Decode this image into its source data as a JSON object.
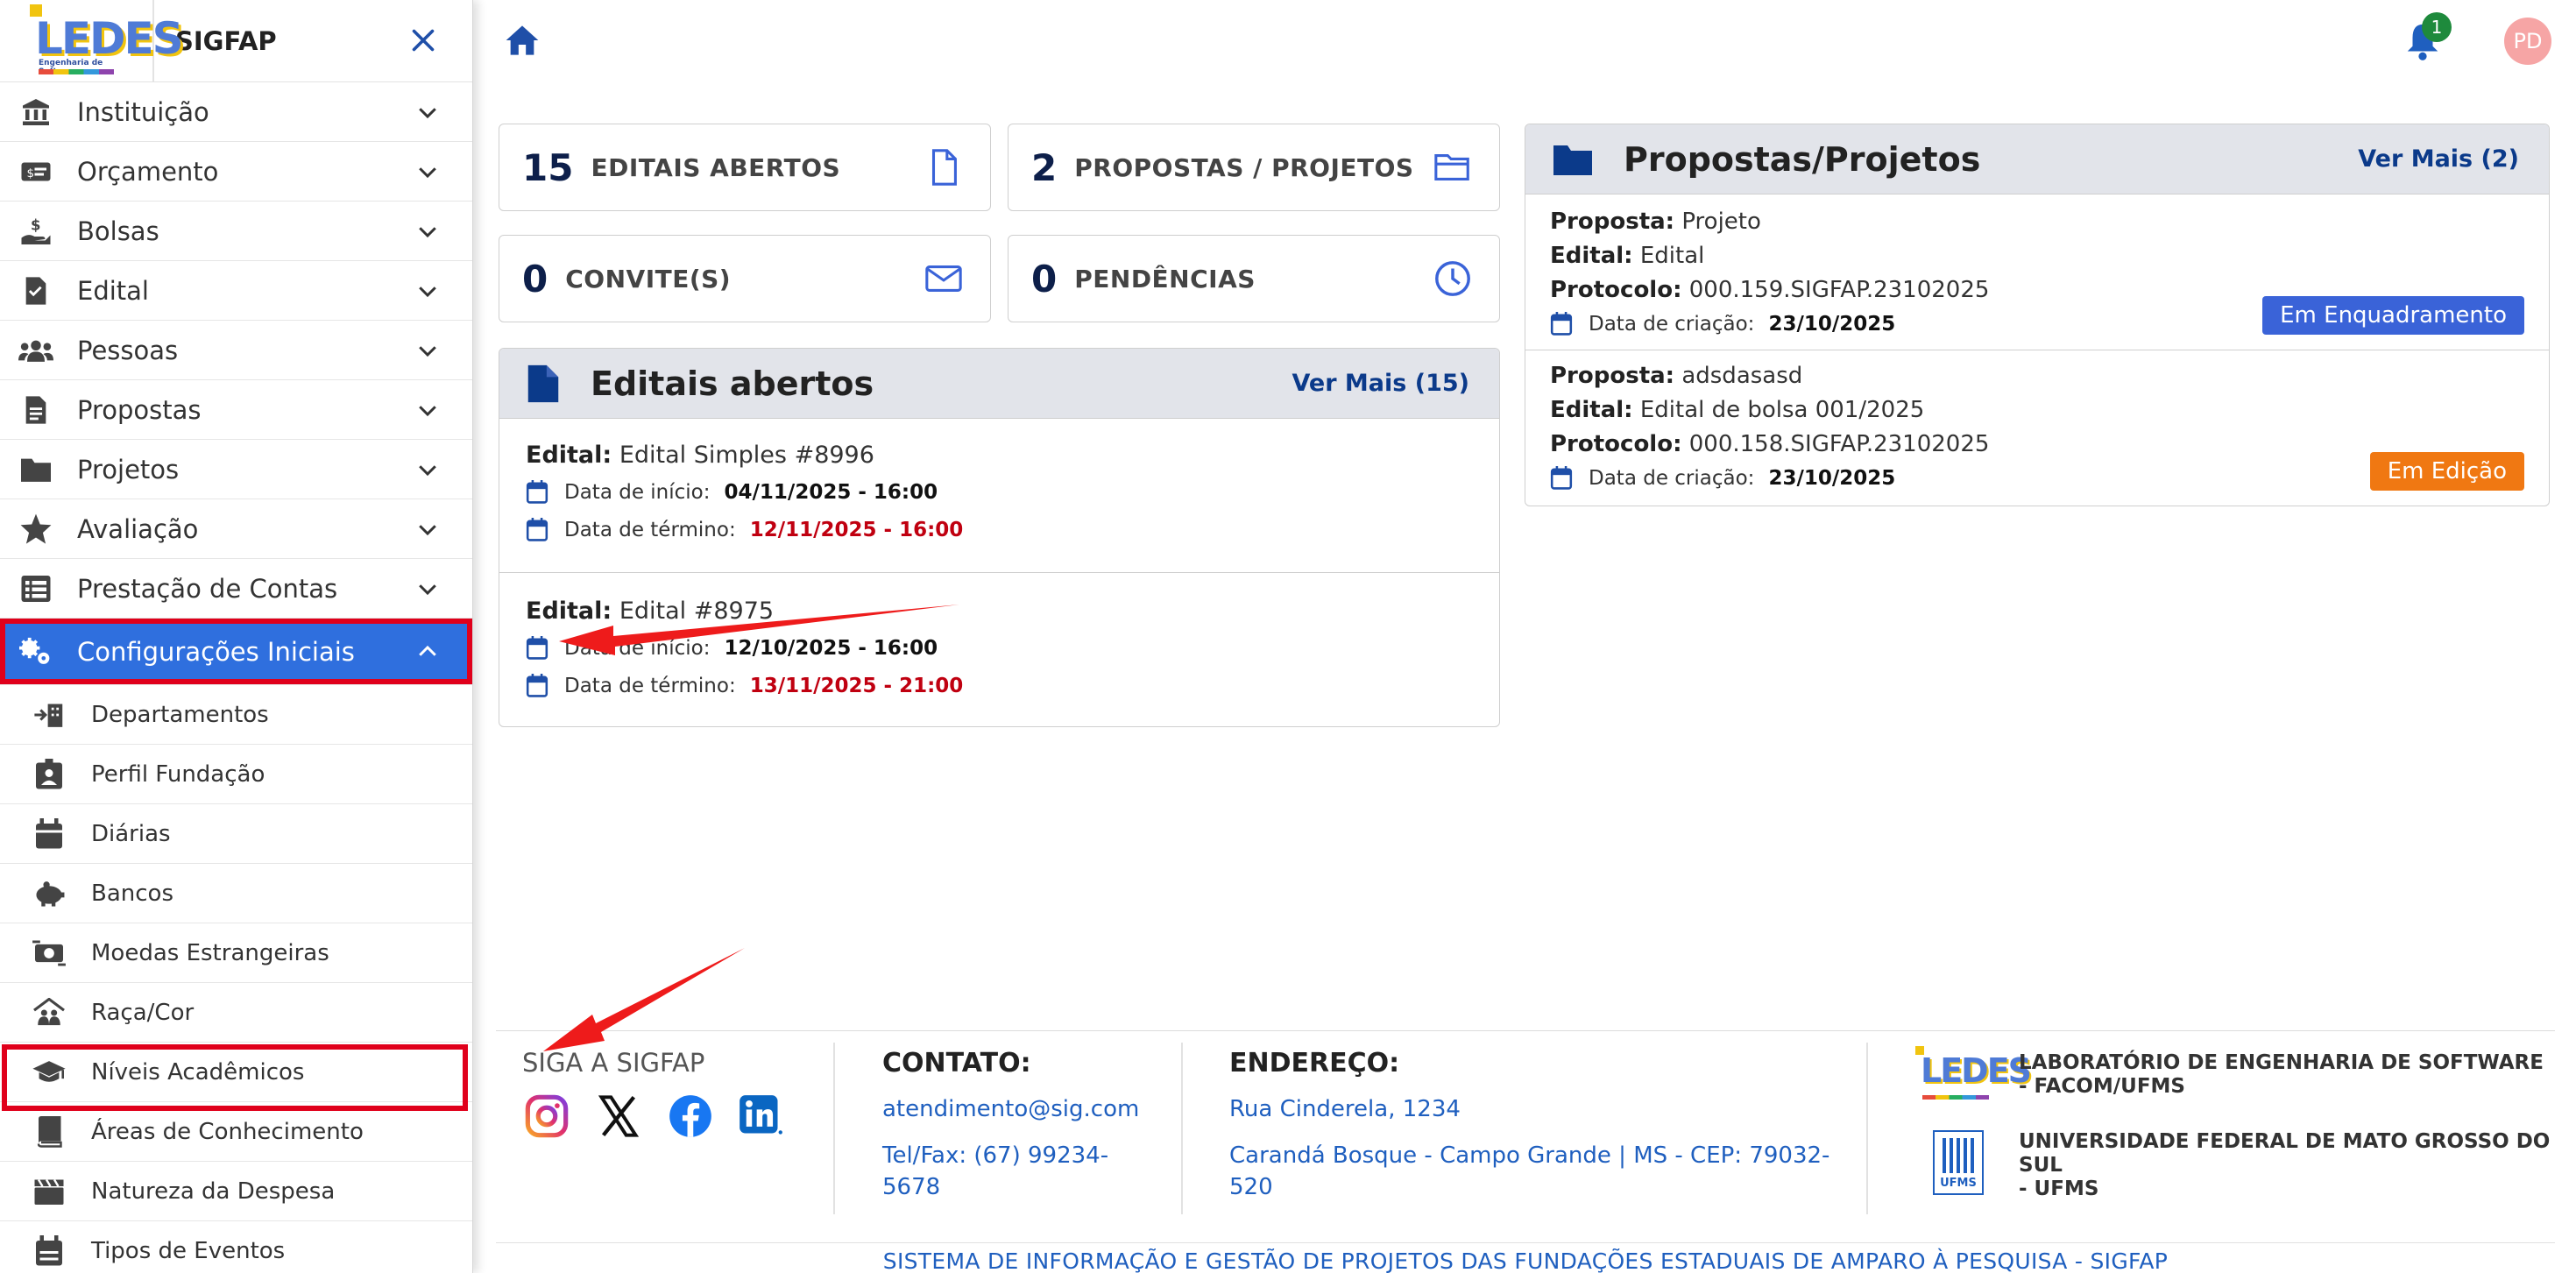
{
  "sidebar": {
    "title": "SIGFAP",
    "logo_text": "LEDES",
    "logo_subtitle": "Engenharia de Software",
    "menu": [
      {
        "label": "Instituição",
        "icon": "bank-icon"
      },
      {
        "label": "Orçamento",
        "icon": "money-bill-icon"
      },
      {
        "label": "Bolsas",
        "icon": "hand-coin-icon"
      },
      {
        "label": "Edital",
        "icon": "document-icon"
      },
      {
        "label": "Pessoas",
        "icon": "users-icon"
      },
      {
        "label": "Propostas",
        "icon": "file-list-icon"
      },
      {
        "label": "Projetos",
        "icon": "folder-icon"
      },
      {
        "label": "Avaliação",
        "icon": "star-icon"
      },
      {
        "label": "Prestação de Contas",
        "icon": "list-icon"
      },
      {
        "label": "Configurações Iniciais",
        "icon": "gears-icon"
      }
    ],
    "submenu": [
      {
        "label": "Departamentos",
        "icon": "building-arrow-icon"
      },
      {
        "label": "Perfil Fundação",
        "icon": "id-badge-icon"
      },
      {
        "label": "Diárias",
        "icon": "calendar-icon"
      },
      {
        "label": "Bancos",
        "icon": "piggy-bank-icon"
      },
      {
        "label": "Moedas Estrangeiras",
        "icon": "money-exchange-icon"
      },
      {
        "label": "Raça/Cor",
        "icon": "people-roof-icon"
      },
      {
        "label": "Níveis Acadêmicos",
        "icon": "graduation-cap-icon"
      },
      {
        "label": "Áreas de Conhecimento",
        "icon": "book-icon"
      },
      {
        "label": "Natureza da Despesa",
        "icon": "clapperboard-icon"
      },
      {
        "label": "Tipos de Eventos",
        "icon": "calendar-list-icon"
      }
    ]
  },
  "topbar": {
    "notification_count": "1",
    "avatar_initials": "PD"
  },
  "stats": [
    {
      "number": "15",
      "label": "EDITAIS ABERTOS",
      "icon": "file-icon"
    },
    {
      "number": "2",
      "label": "PROPOSTAS / PROJETOS",
      "icon": "folder-open-icon"
    },
    {
      "number": "0",
      "label": "CONVITE(S)",
      "icon": "envelope-icon"
    },
    {
      "number": "0",
      "label": "PENDÊNCIAS",
      "icon": "clock-icon"
    }
  ],
  "editais": {
    "title": "Editais abertos",
    "more": "Ver Mais (15)",
    "edital_label": "Edital:",
    "start_label": "Data de início:",
    "end_label": "Data de término:",
    "items": [
      {
        "name": "Edital Simples #8996",
        "start": "04/11/2025 - 16:00",
        "end": "12/11/2025 - 16:00"
      },
      {
        "name": "Edital #8975",
        "start": "12/10/2025 - 16:00",
        "end": "13/11/2025 - 21:00"
      }
    ]
  },
  "propostas": {
    "title": "Propostas/Projetos",
    "more": "Ver Mais (2)",
    "proposta_label": "Proposta:",
    "edital_label": "Edital:",
    "protocolo_label": "Protocolo:",
    "date_label": "Data de criação:",
    "items": [
      {
        "proposta": "Projeto",
        "edital": "Edital",
        "protocolo": "000.159.SIGFAP.23102025",
        "date": "23/10/2025",
        "status": "Em Enquadramento",
        "status_color": "#3a63d8"
      },
      {
        "proposta": "adsdasasd",
        "edital": "Edital de bolsa 001/2025",
        "protocolo": "000.158.SIGFAP.23102025",
        "date": "23/10/2025",
        "status": "Em Edição",
        "status_color": "#f07812"
      }
    ]
  },
  "footer": {
    "siga": "SIGA A SIGFAP",
    "social": [
      "instagram-icon",
      "x-twitter-icon",
      "facebook-icon",
      "linkedin-icon"
    ],
    "contato_title": "CONTATO:",
    "email": "atendimento@sig.com",
    "phone_line1": "Tel/Fax: (67) 99234-",
    "phone_line2": "5678",
    "endereco_title": "ENDEREÇO:",
    "address_line1": "Rua Cinderela, 1234",
    "address_line2a": "Carandá Bosque - Campo Grande | MS - CEP: 79032-",
    "address_line2b": "520",
    "lab_line1": "LABORATÓRIO DE ENGENHARIA DE SOFTWARE",
    "lab_line2": "- FACOM/UFMS",
    "ufms_line1": "UNIVERSIDADE FEDERAL DE MATO GROSSO DO",
    "ufms_line2": "SUL",
    "ufms_line3": "- UFMS",
    "ufms_logo_text": "UFMS",
    "bottom": "SISTEMA DE INFORMAÇÃO E GESTÃO DE PROJETOS DAS FUNDAÇÕES ESTADUAIS DE AMPARO À PESQUISA - SIGFAP"
  },
  "colors": {
    "primary": "#2f6fde",
    "highlight": "#e0001b",
    "navy": "#0b3a8a"
  }
}
